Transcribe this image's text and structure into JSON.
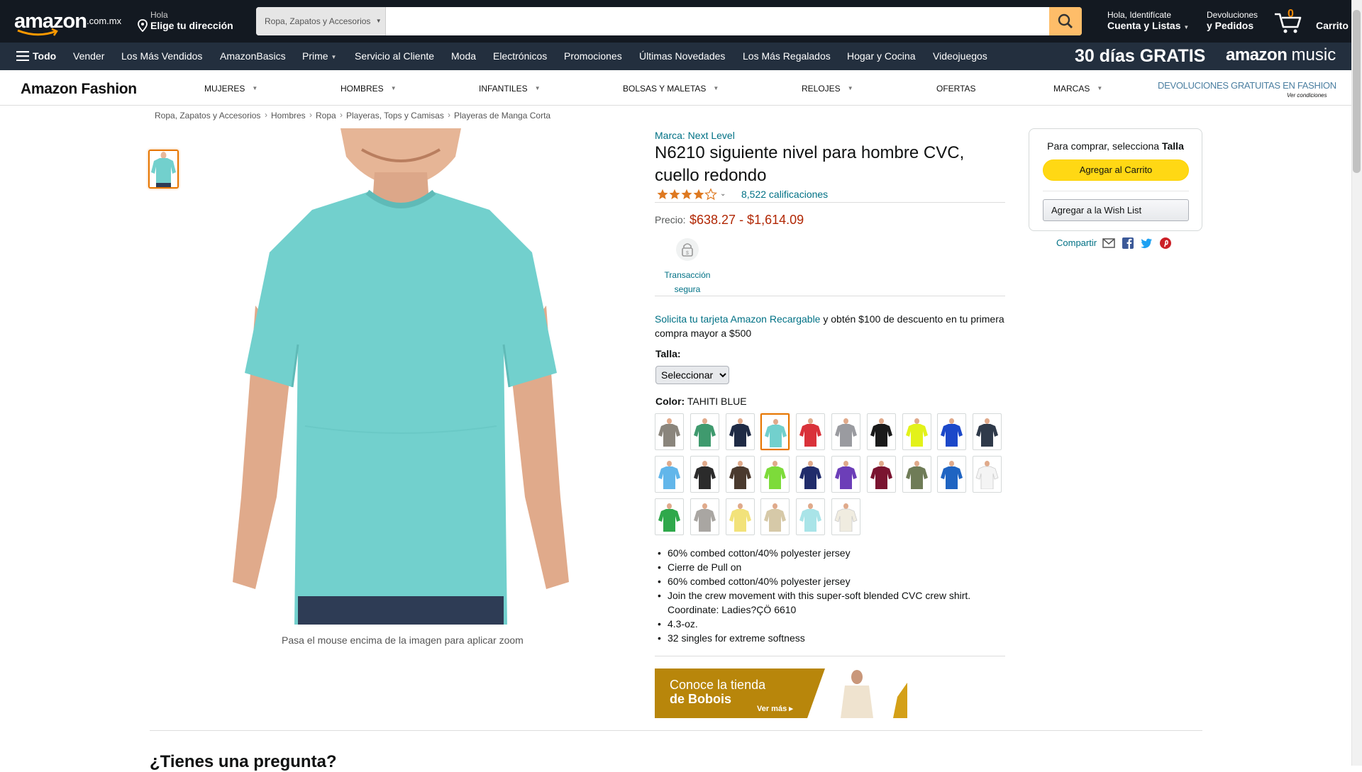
{
  "header": {
    "logo_text": "amazon",
    "logo_suffix": ".com.mx",
    "address_line1": "Hola",
    "address_line2": "Elige tu dirección",
    "search_category": "Ropa, Zapatos y Accesorios",
    "search_placeholder": "",
    "account_line1": "Hola, Identifícate",
    "account_line2": "Cuenta y Listas",
    "returns_line1": "Devoluciones",
    "returns_line2": "y Pedidos",
    "cart_count": "0",
    "cart_label": "Carrito",
    "accent_color": "#febd69"
  },
  "nav": {
    "all_label": "Todo",
    "items": [
      "Vender",
      "Los Más Vendidos",
      "AmazonBasics",
      "Prime",
      "Servicio al Cliente",
      "Moda",
      "Electrónicos",
      "Promociones",
      "Últimas Novedades",
      "Los Más Regalados",
      "Hogar y Cocina",
      "Videojuegos"
    ],
    "promo_text": "30 días GRATIS",
    "promo_brand_a": "amazon",
    "promo_brand_b": "music"
  },
  "fashion_nav": {
    "title": "Amazon Fashion",
    "items": [
      "MUJERES",
      "HOMBRES",
      "INFANTILES",
      "BOLSAS Y MALETAS",
      "RELOJES",
      "OFERTAS",
      "MARCAS"
    ],
    "free_returns": "DEVOLUCIONES GRATUITAS EN FASHION",
    "free_returns_sub": "Ver condiciones"
  },
  "breadcrumb": [
    "Ropa, Zapatos y Accesorios",
    "Hombres",
    "Ropa",
    "Playeras, Tops y Camisas",
    "Playeras de Manga Corta"
  ],
  "gallery": {
    "zoom_hint": "Pasa el mouse encima de la imagen para aplicar zoom",
    "shirt_color": "#72d0cd"
  },
  "product": {
    "brand": "Marca: Next Level",
    "title": "N6210 siguiente nivel para hombre CVC, cuello redondo",
    "rating_value": 4.5,
    "ratings_count": "8,522 calificaciones",
    "price_label": "Precio:",
    "price": "$638.27 - $1,614.09",
    "secure_line1": "Transacción",
    "secure_line2": "segura",
    "credit_link": "Solicita tu tarjeta Amazon Recargable",
    "credit_text": " y obtén $100 de descuento en tu primera compra mayor a $500",
    "size_label": "Talla:",
    "size_value": "Seleccionar",
    "color_label": "Color:",
    "color_value": "TAHITI BLUE",
    "swatches": [
      "#8a857c",
      "#3f9a6e",
      "#1f2b45",
      "#72d0cd",
      "#d9323a",
      "#9a9ba0",
      "#1a1a1a",
      "#e3f21a",
      "#1c48c9",
      "#2f3a4a",
      "#62b6ea",
      "#2b2b2b",
      "#4a3a2e",
      "#7ddb3a",
      "#202c6b",
      "#6c3eb8",
      "#7a1430",
      "#6f7c57",
      "#1f64c2",
      "#f4f4f4",
      "#2fa84b",
      "#a9a6a2",
      "#f2e27a",
      "#d6c9a8",
      "#a9e4e8",
      "#f0ece0"
    ],
    "selected_swatch": 3,
    "bullets": [
      "60% combed cotton/40% polyester jersey",
      "Cierre de Pull on",
      "60% combed cotton/40% polyester jersey",
      "Join the crew movement with this super-soft blended CVC crew shirt. Coordinate: Ladies?ÇÖ 6610",
      "4.3-oz.",
      "32 singles for extreme softness"
    ]
  },
  "banner": {
    "line1": "Conoce la tienda",
    "line2": "de Bobois",
    "cta": "Ver más ▸"
  },
  "questions_title": "¿Tienes una pregunta?",
  "buybox": {
    "prompt": "Para comprar, selecciona ",
    "prompt_bold": "Talla",
    "add_to_cart": "Agregar al Carrito",
    "add_to_wishlist": "Agregar a la Wish List",
    "share": "Compartir",
    "button_color": "#ffd814"
  }
}
